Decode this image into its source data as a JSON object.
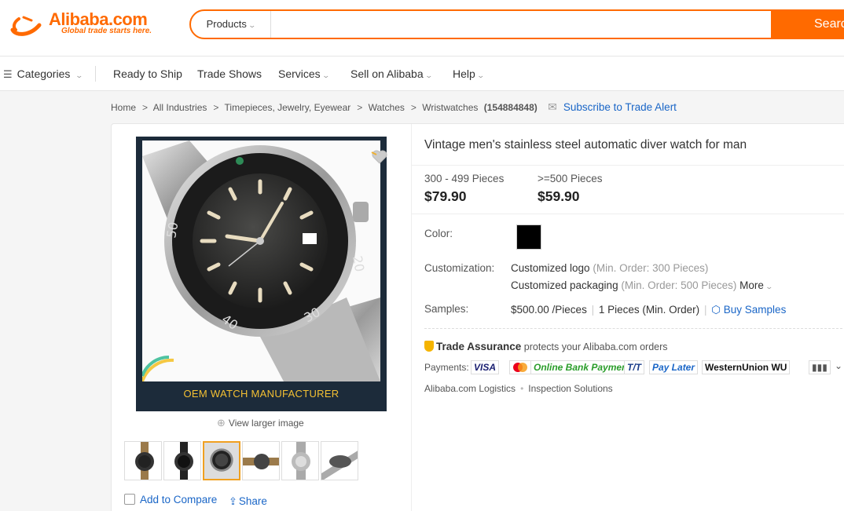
{
  "header": {
    "logo_text": "Alibaba.com",
    "logo_tagline": "Global trade starts here.",
    "search_category": "Products",
    "search_placeholder": "",
    "search_button": "Search"
  },
  "nav": {
    "categories": "Categories",
    "items": [
      "Ready to Ship",
      "Trade Shows",
      "Services",
      "Sell on Alibaba",
      "Help"
    ]
  },
  "breadcrumb": {
    "items": [
      "Home",
      "All Industries",
      "Timepieces, Jewelry, Eyewear",
      "Watches",
      "Wristwatches"
    ],
    "count": "(154884848)",
    "subscribe": "Subscribe to Trade Alert"
  },
  "gallery": {
    "banner_text": "OEM WATCH MANUFACTURER",
    "view_larger": "View larger image",
    "add_to_compare": "Add to Compare",
    "share": "Share"
  },
  "product": {
    "title": "Vintage men's stainless steel automatic diver watch for man",
    "price_tiers": [
      {
        "quantity": "300 - 499 Pieces",
        "price": "$79.90"
      },
      {
        "quantity": ">=500 Pieces",
        "price": "$59.90"
      }
    ],
    "color_label": "Color:",
    "color_value": "#000000",
    "customization_label": "Customization:",
    "customization": [
      {
        "name": "Customized logo",
        "note": "(Min. Order: 300 Pieces)"
      },
      {
        "name": "Customized packaging",
        "note": "(Min. Order: 500 Pieces)"
      }
    ],
    "more": "More",
    "samples_label": "Samples:",
    "samples_price": "$500.00 /Pieces",
    "samples_min": "1 Pieces (Min. Order)",
    "buy_samples": "Buy Samples",
    "trade_assurance": "Trade Assurance",
    "trade_assurance_text": "protects your Alibaba.com orders",
    "payments_label": "Payments:",
    "payments": [
      "VISA",
      "Online Bank Payment",
      "T/T",
      "Pay Later",
      "WesternUnion WU"
    ],
    "logistics": "Alibaba.com Logistics",
    "inspection": "Inspection Solutions"
  },
  "colors": {
    "brand": "#ff6a00",
    "link": "#1a66c7",
    "banner_text": "#f3c033"
  }
}
